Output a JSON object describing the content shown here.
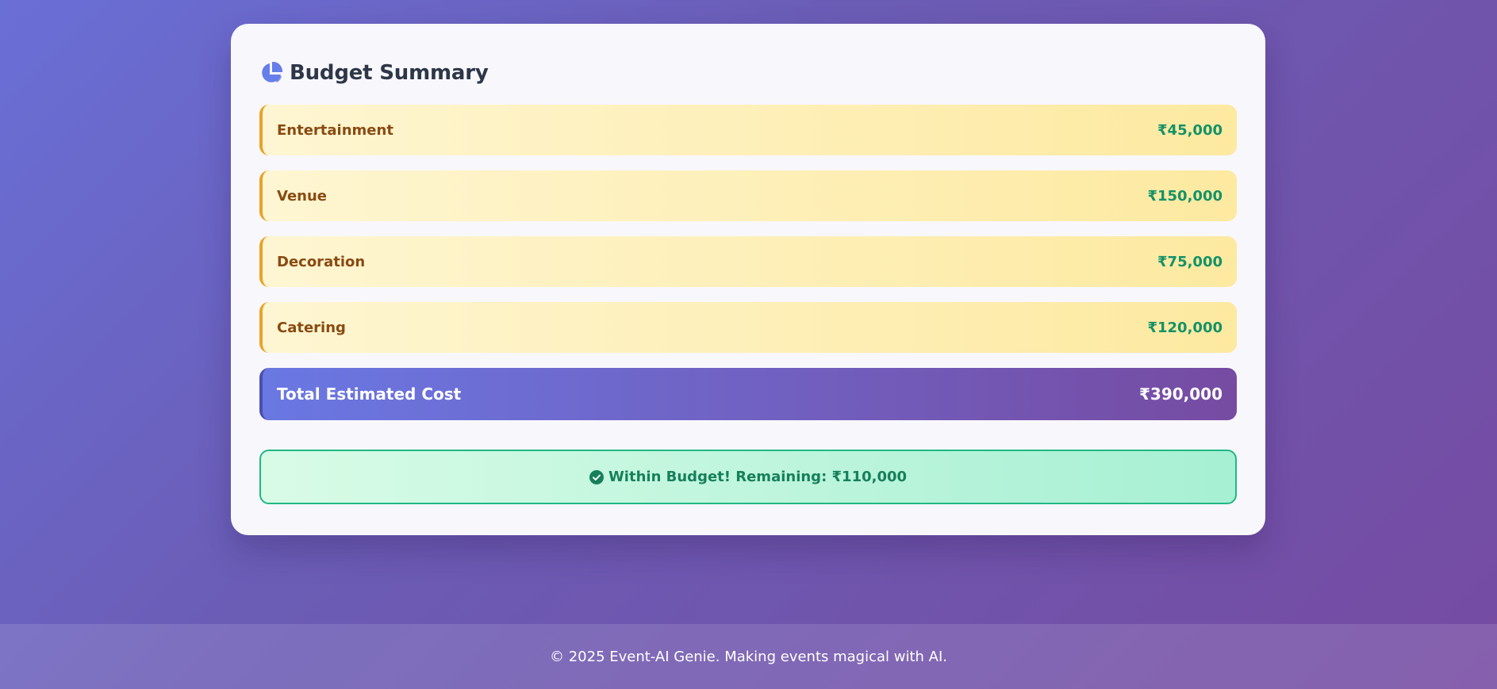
{
  "budget_summary": {
    "title": "Budget Summary",
    "items": [
      {
        "label": "Entertainment",
        "amount": "₹45,000"
      },
      {
        "label": "Venue",
        "amount": "₹150,000"
      },
      {
        "label": "Decoration",
        "amount": "₹75,000"
      },
      {
        "label": "Catering",
        "amount": "₹120,000"
      }
    ],
    "total": {
      "label": "Total Estimated Cost",
      "amount": "₹390,000"
    },
    "status": {
      "text": "Within Budget! Remaining: ₹110,000",
      "icon": "check-circle-icon"
    },
    "header_icon": "pie-chart-icon"
  },
  "footer": {
    "text": "© 2025 Event-AI Genie. Making events magical with AI."
  },
  "colors": {
    "background_start": "#6a6fd6",
    "background_end": "#764ba2",
    "item_border": "#e8a328",
    "item_label": "#8a4a12",
    "amount": "#149268",
    "status_border": "#20b883"
  }
}
